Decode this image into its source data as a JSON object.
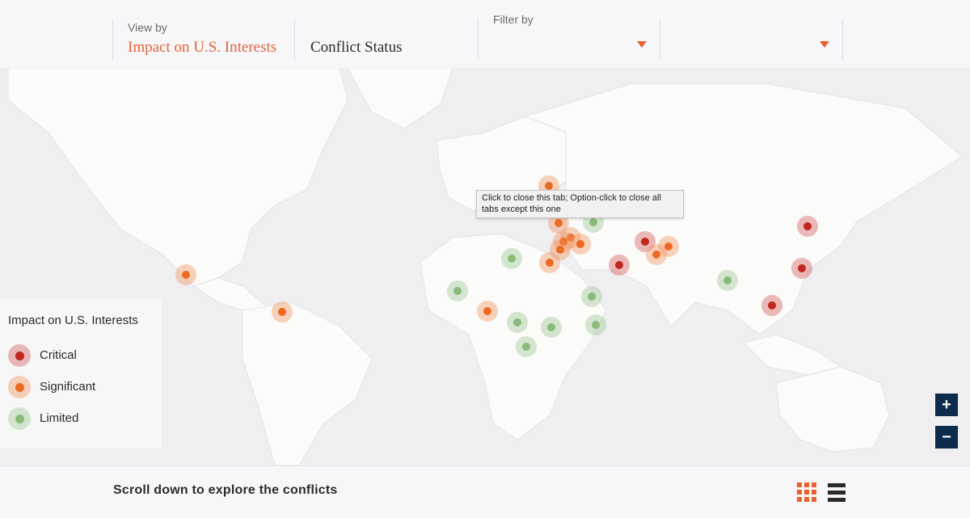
{
  "header": {
    "view_by_label": "View by",
    "tabs": [
      {
        "label": "Impact on U.S. Interests",
        "active": true
      },
      {
        "label": "Conflict Status",
        "active": false
      }
    ],
    "filter_by_label": "Filter by",
    "filters": [
      {
        "value": ""
      },
      {
        "value": ""
      }
    ],
    "accent_color": "#e2643a"
  },
  "tooltip": {
    "text": "Click to close this tab; Option-click to close all tabs except this one"
  },
  "legend": {
    "title": "Impact on U.S. Interests",
    "items": [
      {
        "level": "critical",
        "label": "Critical",
        "color": "#c0271f"
      },
      {
        "level": "significant",
        "label": "Significant",
        "color": "#ec6a23"
      },
      {
        "level": "limited",
        "label": "Limited",
        "color": "#88bb7a"
      }
    ]
  },
  "markers": [
    {
      "level": "significant"
    },
    {
      "level": "significant"
    },
    {
      "level": "significant"
    },
    {
      "level": "limited"
    },
    {
      "level": "significant"
    },
    {
      "level": "significant"
    },
    {
      "level": "significant"
    },
    {
      "level": "significant"
    },
    {
      "level": "significant"
    },
    {
      "level": "significant"
    },
    {
      "level": "limited"
    },
    {
      "level": "critical"
    },
    {
      "level": "critical"
    },
    {
      "level": "significant"
    },
    {
      "level": "significant"
    },
    {
      "level": "critical"
    },
    {
      "level": "critical"
    },
    {
      "level": "critical"
    },
    {
      "level": "limited"
    },
    {
      "level": "limited"
    },
    {
      "level": "limited"
    },
    {
      "level": "significant"
    },
    {
      "level": "limited"
    },
    {
      "level": "limited"
    },
    {
      "level": "limited"
    },
    {
      "level": "limited"
    },
    {
      "level": "limited"
    },
    {
      "level": "critical"
    }
  ],
  "zoom": {
    "in_label": "+",
    "out_label": "−"
  },
  "footer": {
    "scroll_text": "Scroll down to explore the conflicts",
    "grid_icon": "grid-icon",
    "list_icon": "list-icon"
  }
}
